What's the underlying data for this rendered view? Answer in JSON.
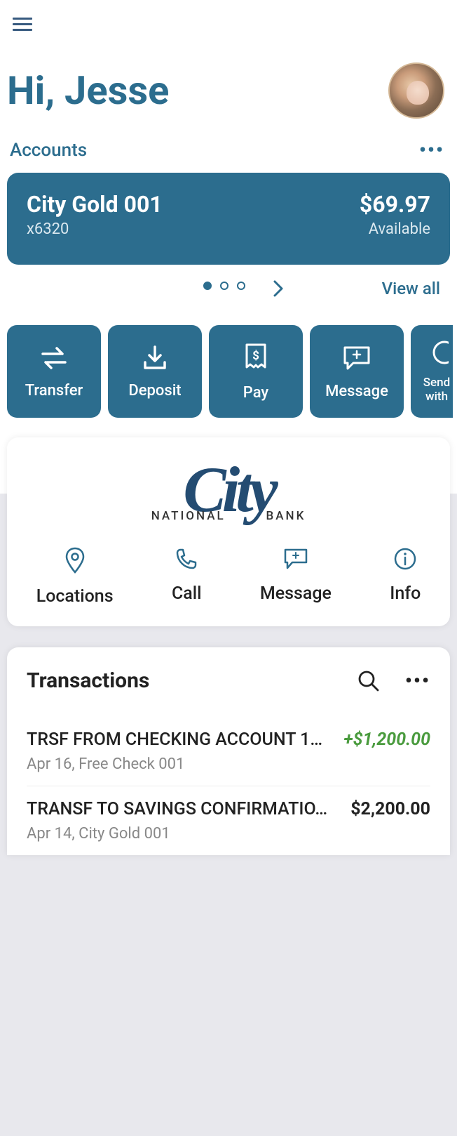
{
  "greeting": "Hi, Jesse",
  "accounts_label": "Accounts",
  "account": {
    "name": "City Gold 001",
    "masked": "x6320",
    "balance": "$69.97",
    "available_label": "Available"
  },
  "view_all": "View all",
  "actions": [
    {
      "label": "Transfer"
    },
    {
      "label": "Deposit"
    },
    {
      "label": "Pay"
    },
    {
      "label": "Message"
    },
    {
      "label_line1": "Send",
      "label_line2": "with"
    }
  ],
  "bank": {
    "logo_main": "City",
    "logo_sub_left": "NATIONAL",
    "logo_sub_right": "BANK",
    "actions": [
      {
        "label": "Locations"
      },
      {
        "label": "Call"
      },
      {
        "label": "Message"
      },
      {
        "label": "Info"
      }
    ]
  },
  "transactions": {
    "title": "Transactions",
    "items": [
      {
        "desc": "TRSF FROM CHECKING ACCOUNT 1…",
        "amount": "+$1,200.00",
        "sub": "Apr 16, Free Check 001",
        "positive": true
      },
      {
        "desc": "TRANSF TO SAVINGS CONFIRMATIO…",
        "amount": "$2,200.00",
        "sub": "Apr 14, City Gold 001",
        "positive": false
      }
    ]
  }
}
